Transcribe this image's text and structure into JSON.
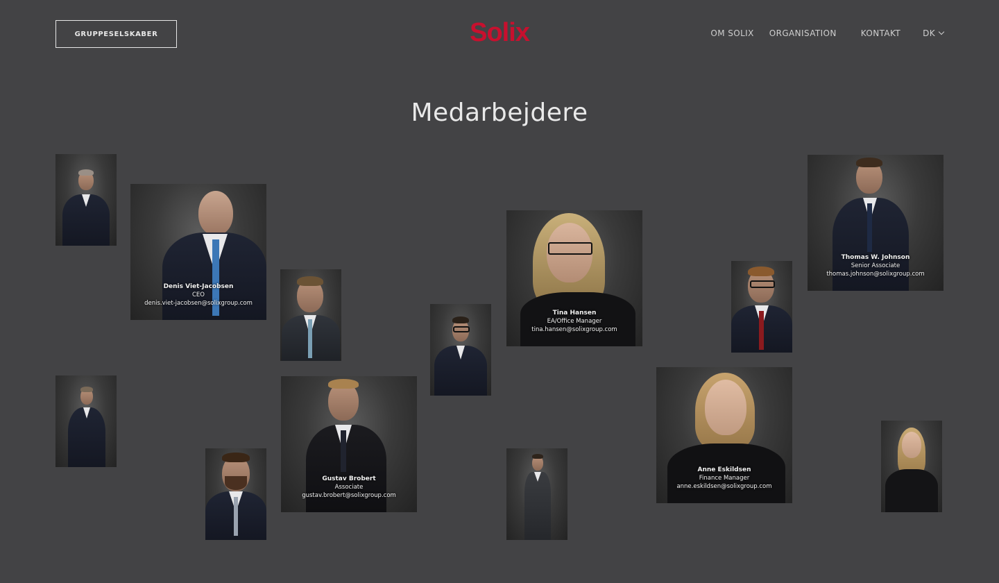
{
  "header": {
    "group_button": "GRUPPESELSKABER",
    "logo": "Solix",
    "nav": [
      "OM SOLIX",
      "ORGANISATION",
      "KONTAKT"
    ],
    "language": "DK",
    "logo_color": "#c8102e"
  },
  "page_title": "Medarbejdere",
  "employees": [
    {
      "name": "Denis Viet-Jacobsen",
      "role": "CEO",
      "email": "denis.viet-jacobsen@solixgroup.com"
    },
    {
      "name": "Tina Hansen",
      "role": "EA/Office Manager",
      "email": "tina.hansen@solixgroup.com"
    },
    {
      "name": "Thomas W. Johnson",
      "role": "Senior Associate",
      "email": "thomas.johnson@solixgroup.com"
    },
    {
      "name": "Gustav Brobert",
      "role": "Associate",
      "email": "gustav.brobert@solixgroup.com"
    },
    {
      "name": "Anne Eskildsen",
      "role": "Finance Manager",
      "email": "anne.eskildsen@solixgroup.com"
    }
  ],
  "colors": {
    "background": "#434345",
    "text": "#e8e8e8"
  }
}
